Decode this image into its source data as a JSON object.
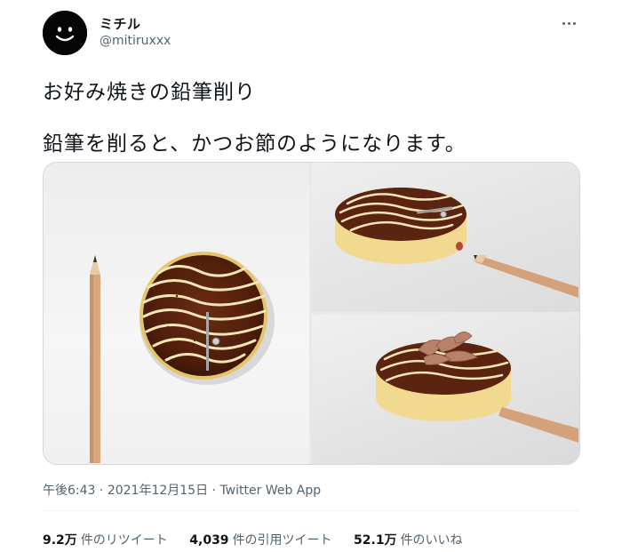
{
  "user": {
    "display_name": "ミチル",
    "handle": "@mitiruxxx"
  },
  "tweet": {
    "line1": "お好み焼きの鉛筆削り",
    "line2": "鉛筆を削ると、かつお節のようになります。"
  },
  "meta": {
    "time": "午後6:43",
    "sep1": "·",
    "date": "2021年12月15日",
    "sep2": "·",
    "client": "Twitter Web App"
  },
  "stats": {
    "retweets_count": "9.2万",
    "retweets_label": "件のリツイート",
    "quotes_count": "4,039",
    "quotes_label": "件の引用ツイート",
    "likes_count": "52.1万",
    "likes_label": "件のいいね"
  },
  "icons": {
    "avatar": "smiley-avatar-icon",
    "more": "more-options-icon"
  },
  "colors": {
    "text": "#0f1419",
    "secondary": "#536471",
    "border": "#cfd9de",
    "sauce": "#5a2410",
    "mayo": "#f4e6b8",
    "pancake_side": "#f3dc97",
    "pencil": "#d4a27a"
  }
}
